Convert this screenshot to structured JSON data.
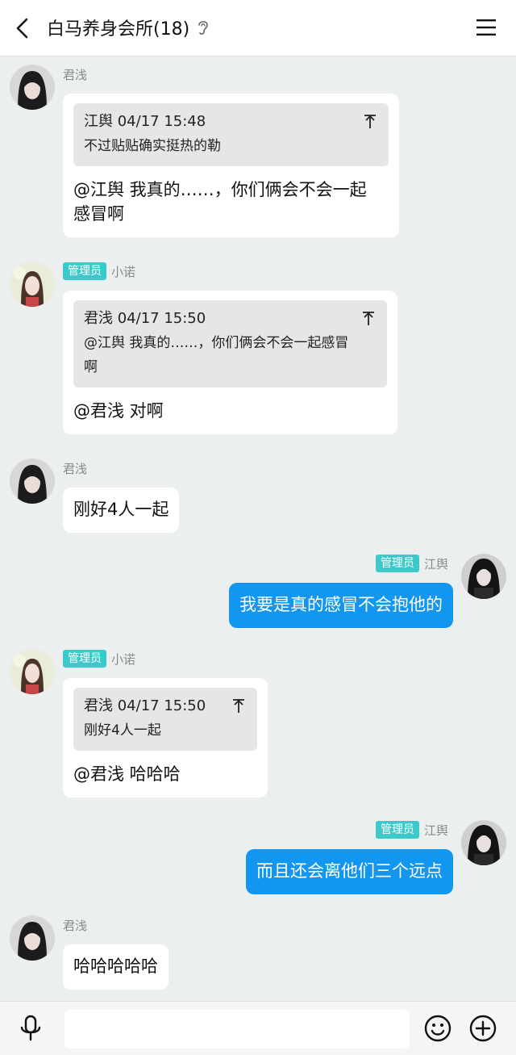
{
  "header": {
    "title": "白马养身会所(18)",
    "back_icon": "back-chevron-icon",
    "ear_icon": "ear-icon",
    "menu_icon": "hamburger-menu-icon"
  },
  "colors": {
    "accent": "#1296f0",
    "badge": "#3dc8c9",
    "background": "#ebeff0"
  },
  "messages": [
    {
      "sender": "君浅",
      "badge": "",
      "quote": {
        "head": "江舆 04/17 15:48",
        "text": "不过贴贴确实挺热的勒"
      },
      "text": "@江舆 我真的……，你们俩会不会一起\n感冒啊"
    },
    {
      "sender": "小诺",
      "badge": "管理员",
      "quote": {
        "head": "君浅 04/17 15:50",
        "text": "@江舆 我真的……，你们俩会不会一起感冒\n啊"
      },
      "text": "@君浅 对啊"
    },
    {
      "sender": "君浅",
      "badge": "",
      "text": "刚好4人一起"
    },
    {
      "sender": "江舆",
      "badge": "管理员",
      "text": "我要是真的感冒不会抱他的"
    },
    {
      "sender": "小诺",
      "badge": "管理员",
      "quote": {
        "head": "君浅 04/17 15:50",
        "text": "刚好4人一起"
      },
      "text": "@君浅 哈哈哈"
    },
    {
      "sender": "江舆",
      "badge": "管理员",
      "text": "而且还会离他们三个远点"
    },
    {
      "sender": "君浅",
      "badge": "",
      "text": "哈哈哈哈哈"
    }
  ],
  "input": {
    "placeholder": ""
  }
}
